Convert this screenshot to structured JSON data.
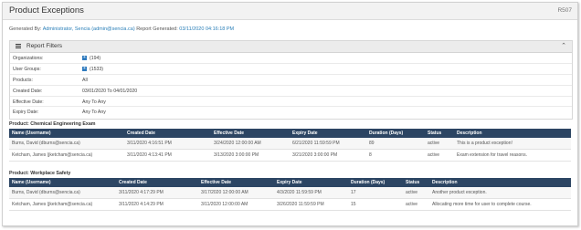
{
  "header": {
    "title": "Product Exceptions",
    "report_code": "R507"
  },
  "generated": {
    "by_label": "Generated By:",
    "by_value": "Administrator, Sencia (admin@sencia.ca)",
    "report_label": "Report Generated:",
    "report_value": "03/11/2020 04:16:18 PM"
  },
  "filters": {
    "title": "Report Filters",
    "rows": [
      {
        "label": "Organizations:",
        "value": "(194)"
      },
      {
        "label": "User Groups:",
        "value": "(1533)"
      },
      {
        "label": "Products:",
        "value": "All"
      },
      {
        "label": "Created Date:",
        "value": "03/01/2020 To 04/01/2020"
      },
      {
        "label": "Effective Date:",
        "value": "Any To Any"
      },
      {
        "label": "Expiry Date:",
        "value": "Any To Any"
      }
    ]
  },
  "columns": [
    "Name (Username)",
    "Created Date",
    "Effective Date",
    "Expiry Date",
    "Duration (Days)",
    "Status",
    "Description"
  ],
  "products": [
    {
      "label": "Product: Chemical Engineering Exam",
      "rows": [
        [
          "Burns, David (dburns@sencia.ca)",
          "3/11/2020 4:16:51 PM",
          "3/24/2020 12:00:00 AM",
          "6/21/2020 11:59:59 PM",
          "89",
          "active",
          "This is a product exception!"
        ],
        [
          "Ketcham, James (jketcham@sencia.ca)",
          "3/11/2020 4:13:41 PM",
          "3/13/2020 3:00:00 PM",
          "3/21/2020 3:00:00 PM",
          "8",
          "active",
          "Exam extension for travel reasons."
        ]
      ]
    },
    {
      "label": "Product: Workplace Safety",
      "rows": [
        [
          "Burns, David (dburns@sencia.ca)",
          "3/11/2020 4:17:29 PM",
          "3/17/2020 12:00:00 AM",
          "4/3/2020 11:59:59 PM",
          "17",
          "active",
          "Another product exception."
        ],
        [
          "Ketcham, James (jketcham@sencia.ca)",
          "3/11/2020 4:14:29 PM",
          "3/11/2020 12:00:00 AM",
          "3/26/2020 11:59:59 PM",
          "15",
          "active",
          "Allocating more time for user to complete course."
        ]
      ]
    }
  ]
}
